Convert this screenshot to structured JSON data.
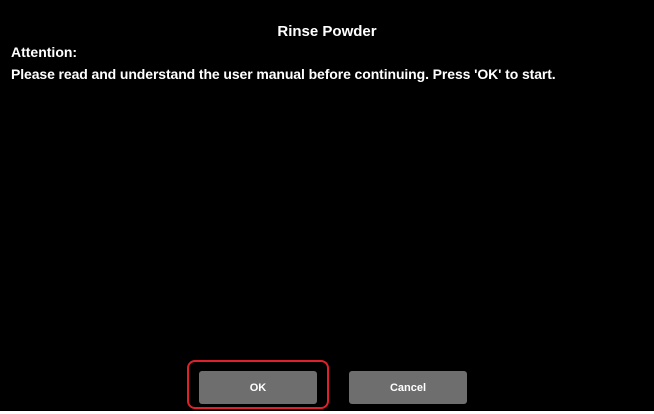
{
  "dialog": {
    "title": "Rinse Powder",
    "attention_label": "Attention:",
    "message": "Please read and understand the user manual before continuing. Press 'OK' to start."
  },
  "buttons": {
    "ok_label": "OK",
    "cancel_label": "Cancel"
  },
  "colors": {
    "background": "#000000",
    "text": "#ffffff",
    "button": "#6e6e6e",
    "highlight": "#e0202a"
  }
}
